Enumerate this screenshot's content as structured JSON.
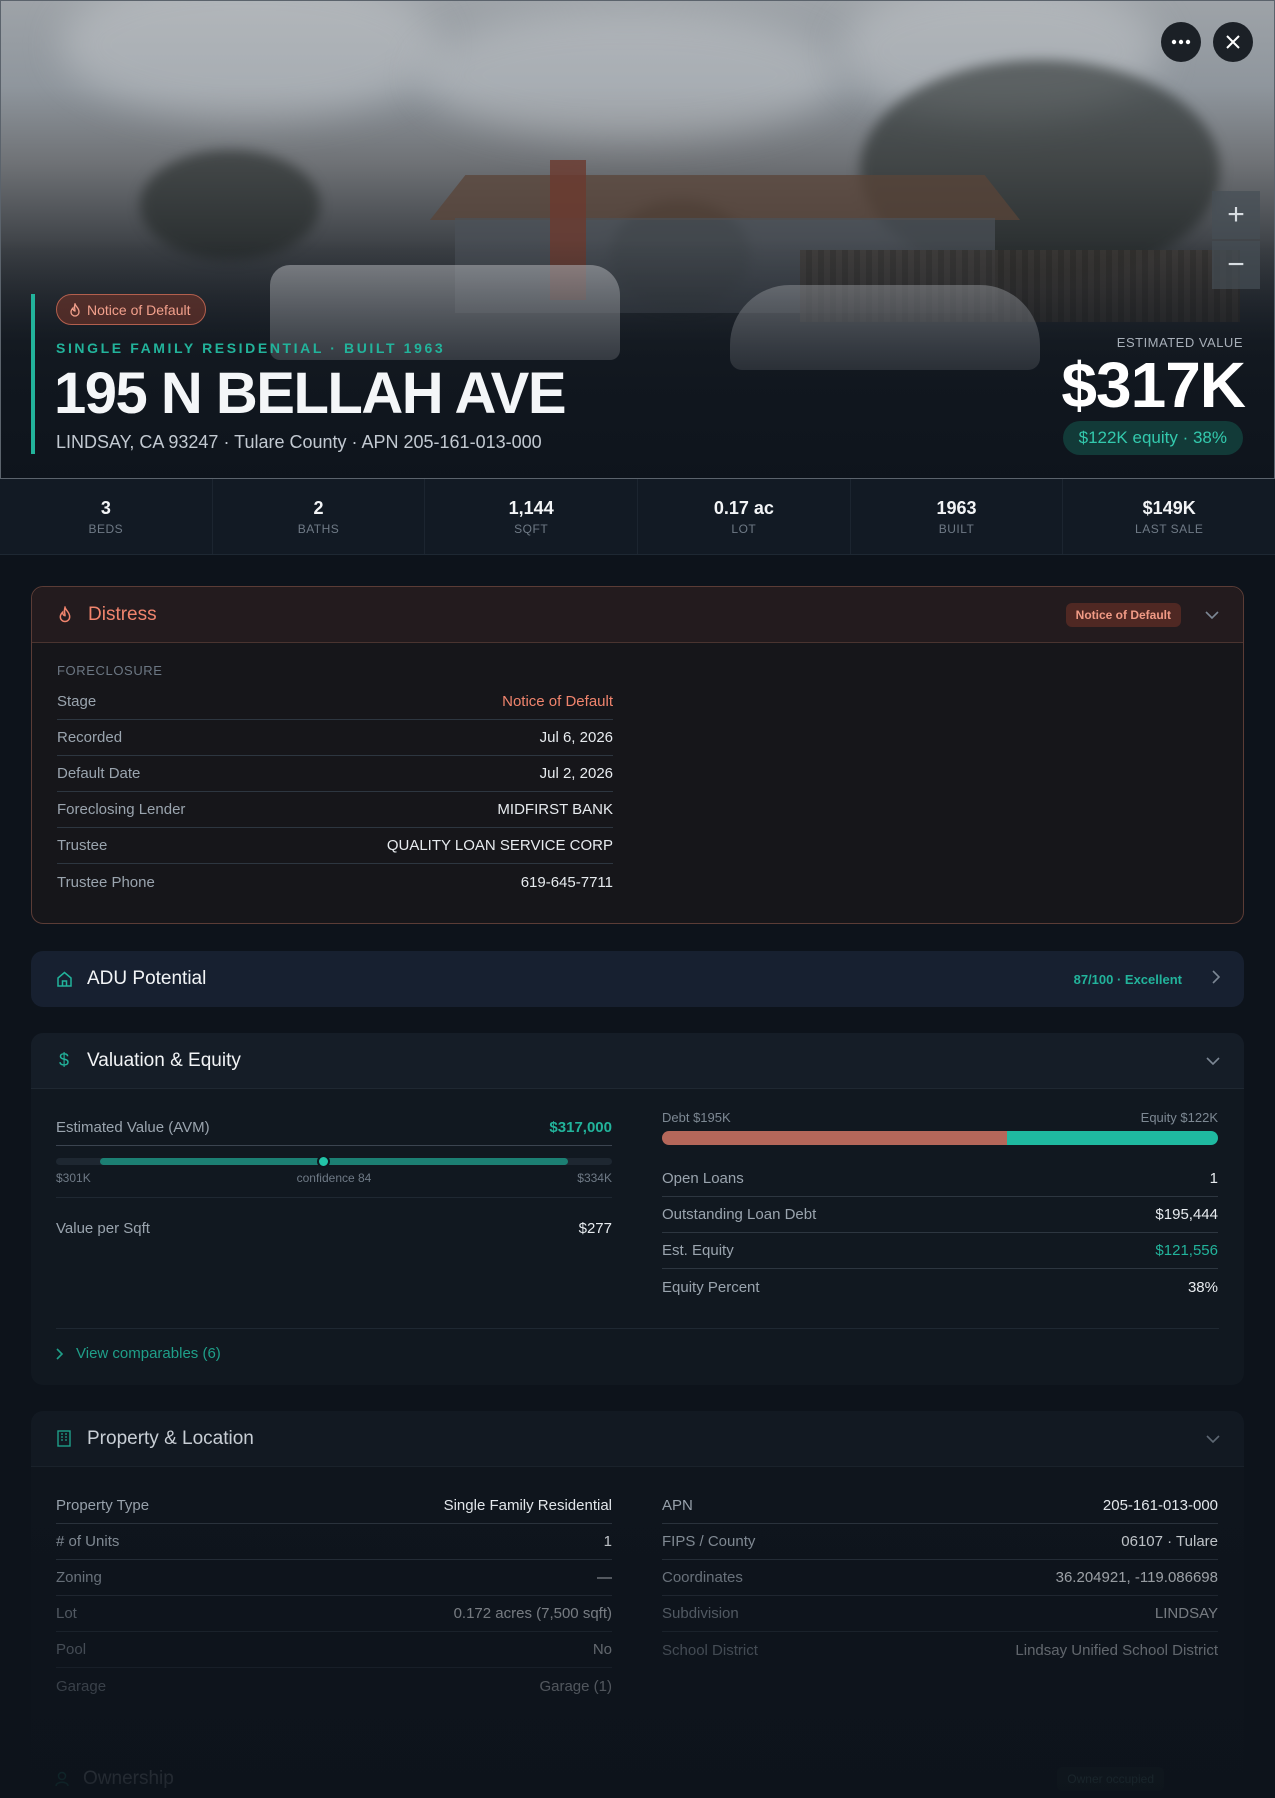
{
  "hero": {
    "status_pill": "Notice of Default",
    "kicker": "SINGLE FAMILY RESIDENTIAL · BUILT 1963",
    "address": "195 N BELLAH AVE",
    "subaddress": "LINDSAY, CA 93247 · Tulare County · APN 205-161-013-000",
    "estimated_value_label": "ESTIMATED VALUE",
    "estimated_value": "$317K",
    "equity_pill": "$122K equity · 38%",
    "map_zoom_in": "+",
    "map_zoom_out": "−"
  },
  "stats": [
    {
      "value": "3",
      "label": "BEDS"
    },
    {
      "value": "2",
      "label": "BATHS"
    },
    {
      "value": "1,144",
      "label": "SQFT"
    },
    {
      "value": "0.17 ac",
      "label": "LOT"
    },
    {
      "value": "1963",
      "label": "BUILT"
    },
    {
      "value": "$149K",
      "label": "LAST SALE"
    }
  ],
  "distress": {
    "title": "Distress",
    "badge": "Notice of Default",
    "section_label": "FORECLOSURE",
    "rows": [
      {
        "k": "Stage",
        "v": "Notice of Default"
      },
      {
        "k": "Recorded",
        "v": "Jul 6, 2026"
      },
      {
        "k": "Default Date",
        "v": "Jul 2, 2026"
      },
      {
        "k": "Foreclosing Lender",
        "v": "MIDFIRST BANK"
      },
      {
        "k": "Trustee",
        "v": "QUALITY LOAN SERVICE CORP"
      },
      {
        "k": "Trustee Phone",
        "v": "619-645-7711"
      }
    ]
  },
  "adu": {
    "title": "ADU Potential",
    "score": "87/100 · Excellent"
  },
  "valuation": {
    "title": "Valuation & Equity",
    "avm_label": "Estimated Value (AVM)",
    "avm_value": "$317,000",
    "range_low": "$301K",
    "range_mid": "confidence 84",
    "range_high": "$334K",
    "range_marker_fraction": 0.48,
    "range_fill_start_fraction": 0.08,
    "range_fill_end_fraction": 0.92,
    "vps_label": "Value per Sqft",
    "vps_value": "$277",
    "debt_label": "Debt $195K",
    "equity_label": "Equity $122K",
    "debt_fraction": 0.62,
    "debt_color": "#b5675a",
    "equity_color": "#1fb9a0",
    "rows": [
      {
        "k": "Open Loans",
        "v": "1"
      },
      {
        "k": "Outstanding Loan Debt",
        "v": "$195,444"
      },
      {
        "k": "Est. Equity",
        "v": "$121,556"
      },
      {
        "k": "Equity Percent",
        "v": "38%"
      }
    ],
    "comparables_link": "View comparables (6)"
  },
  "property": {
    "title": "Property & Location",
    "left_rows": [
      {
        "k": "Property Type",
        "v": "Single Family Residential"
      },
      {
        "k": "# of Units",
        "v": "1"
      },
      {
        "k": "Zoning",
        "v": "—"
      },
      {
        "k": "Lot",
        "v": "0.172 acres (7,500 sqft)"
      },
      {
        "k": "Pool",
        "v": "No"
      },
      {
        "k": "Garage",
        "v": "Garage (1)"
      }
    ],
    "right_rows": [
      {
        "k": "APN",
        "v": "205-161-013-000"
      },
      {
        "k": "FIPS / County",
        "v": "06107 · Tulare"
      },
      {
        "k": "Coordinates",
        "v": "36.204921, -119.086698"
      },
      {
        "k": "Subdivision",
        "v": "LINDSAY"
      },
      {
        "k": "School District",
        "v": "Lindsay Unified School District"
      }
    ]
  },
  "ownership": {
    "title": "Ownership",
    "badge": "Owner occupied"
  },
  "colors": {
    "accent": "#22b39b",
    "distress": "#f0846d",
    "background": "#0d131b"
  }
}
